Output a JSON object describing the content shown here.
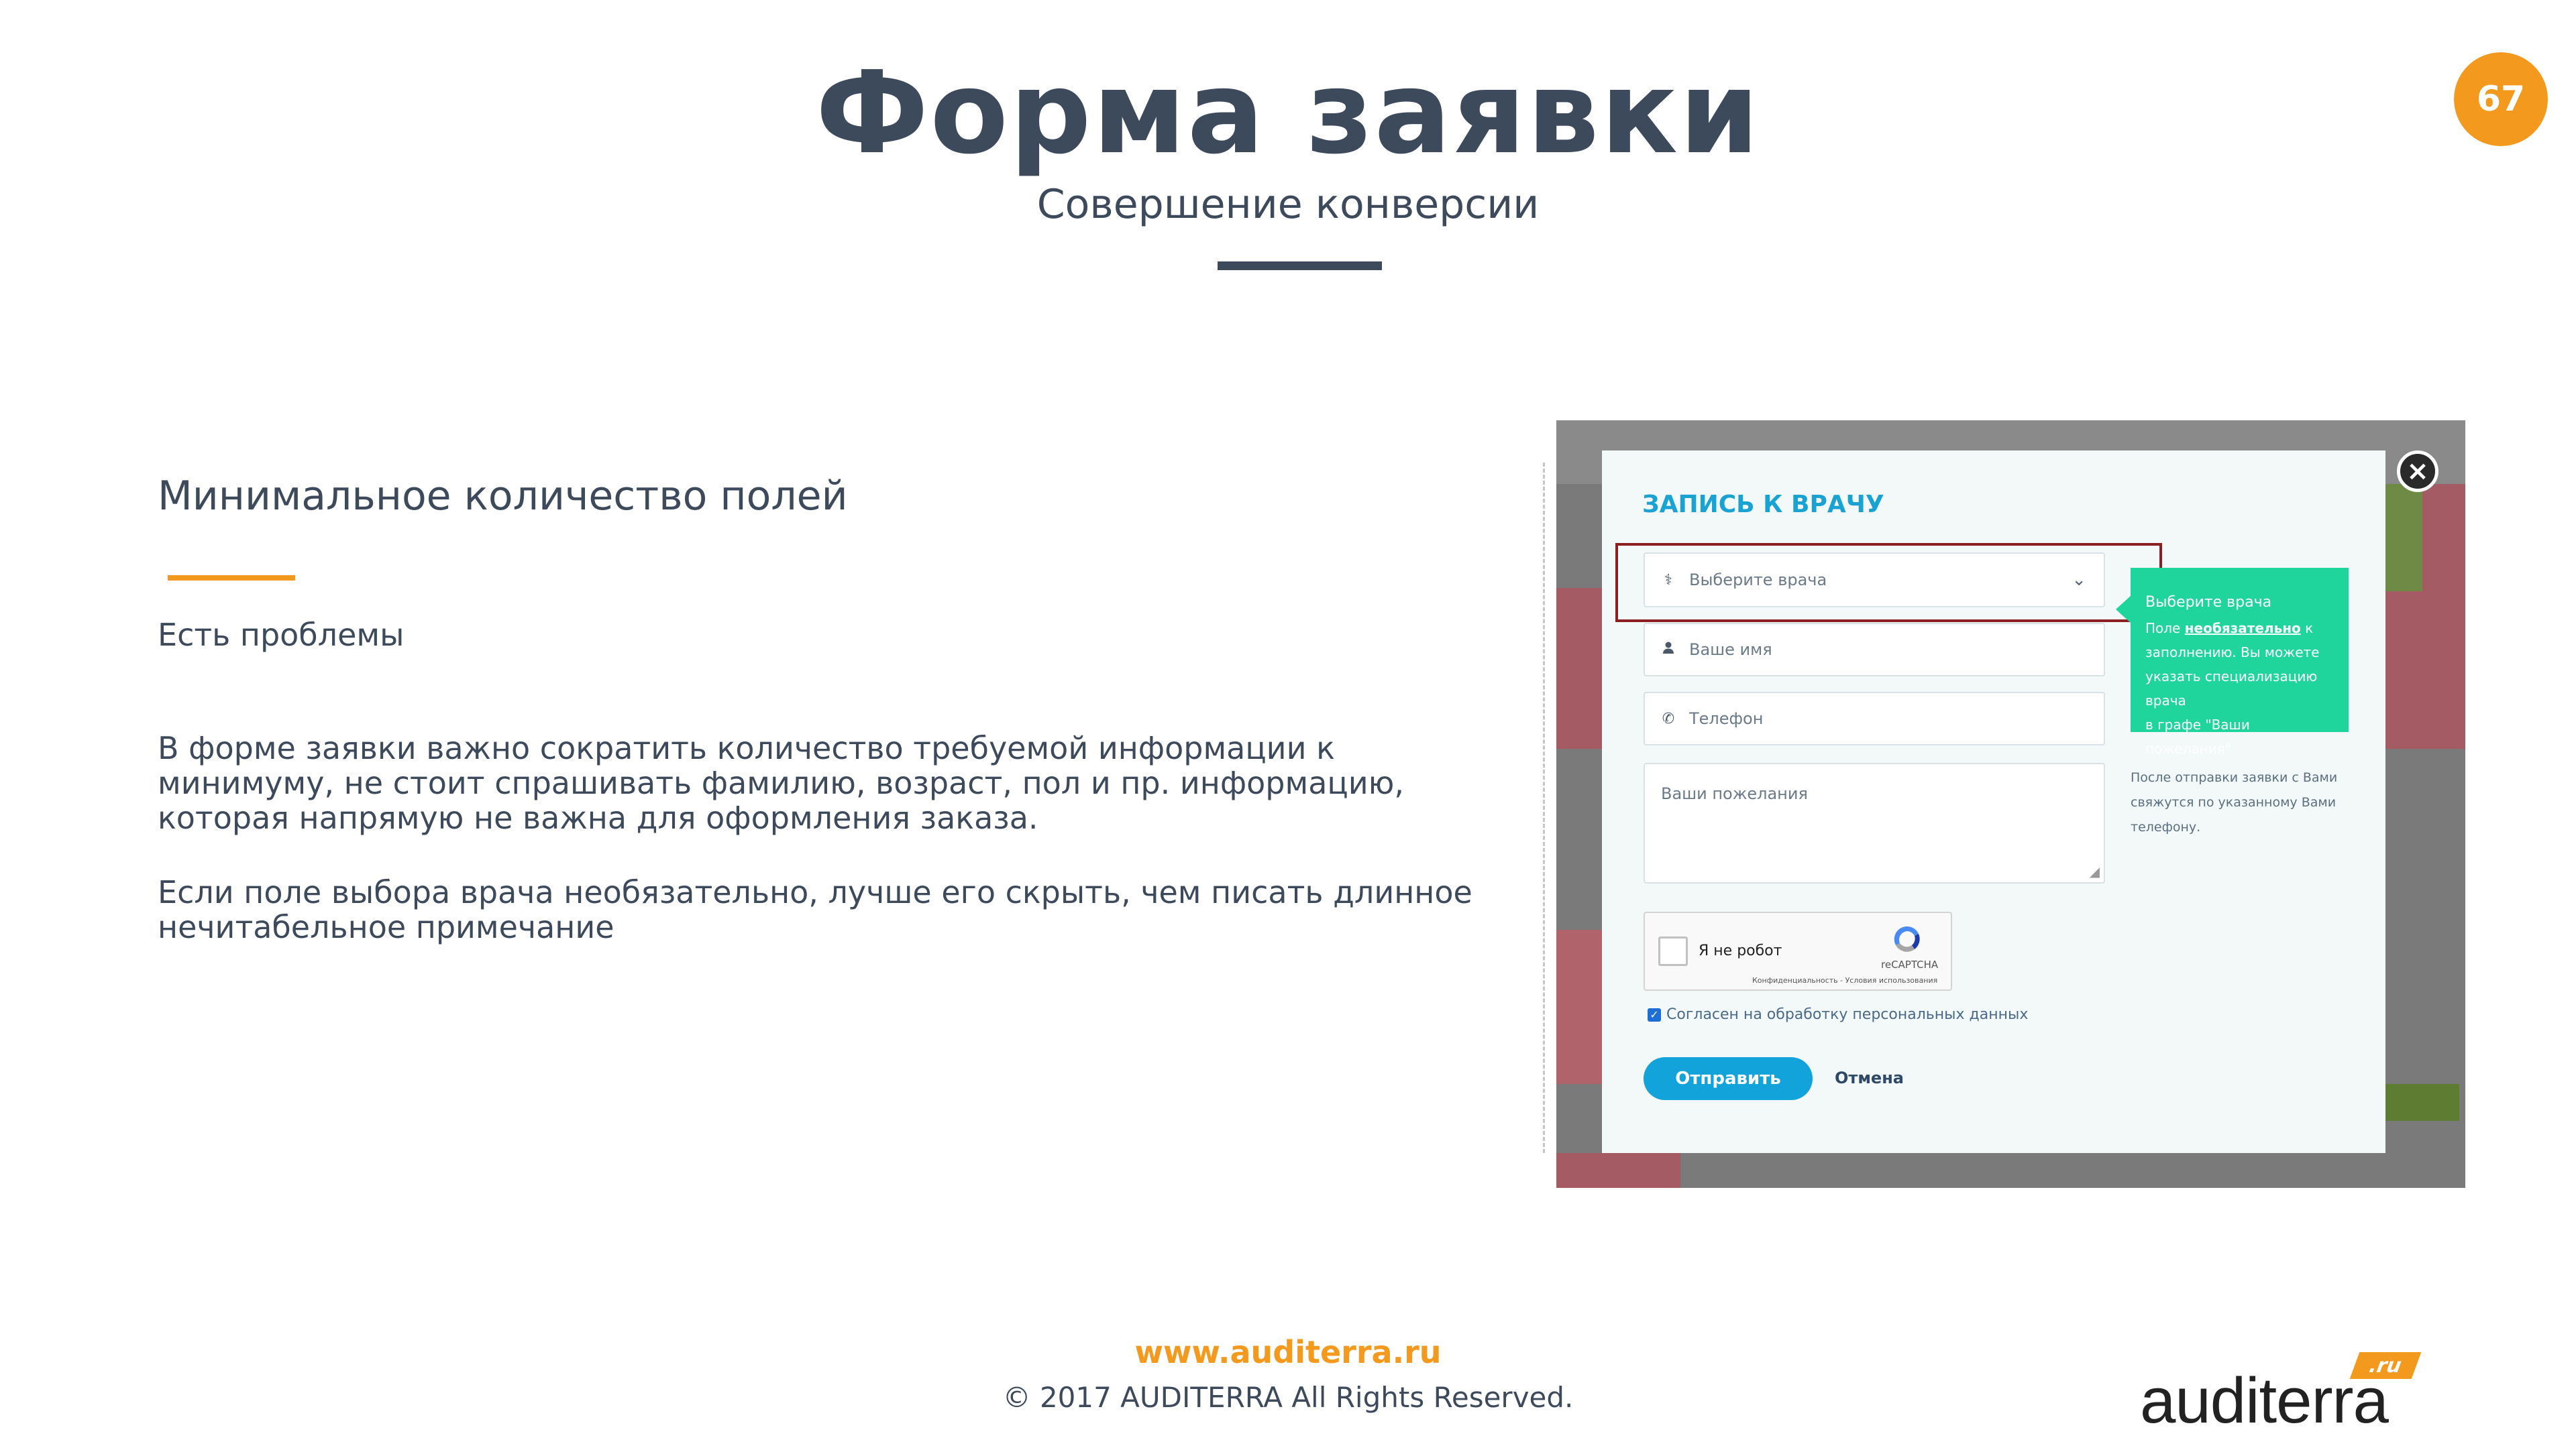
{
  "header": {
    "title": "Форма заявки",
    "subtitle": "Совершение конверсии",
    "page_number": "67"
  },
  "content": {
    "heading": "Минимальное количество полей",
    "problems_label": "Есть проблемы",
    "paragraph_1": "В форме заявки важно сократить количество требуемой информации к минимуму, не стоит спрашивать фамилию, возраст, пол и пр. информацию, которая напрямую не важна для оформления заказа.",
    "paragraph_2": "Если поле выбора врача необязательно, лучше его скрыть, чем писать длинное нечитабельное примечание"
  },
  "form": {
    "title": "ЗАПИСЬ К ВРАЧУ",
    "close_icon": "×",
    "doctor_placeholder": "Выберите врача",
    "name_placeholder": "Ваше имя",
    "phone_placeholder": "Телефон",
    "wishes_placeholder": "Ваши пожелания",
    "tooltip": {
      "title": "Выберите врача",
      "line_1_pre": "Поле ",
      "line_1_strong": "необязательно",
      "line_1_post": " к",
      "line_2": "заполнению. Вы можете",
      "line_3": "указать специализацию врача",
      "line_4": "в графе \"Ваши пожелания\""
    },
    "after_note": "После отправки заявки с Вами свяжутся по указанному Вами телефону.",
    "captcha": {
      "label": "Я не робот",
      "brand": "reCAPTCHA",
      "terms": "Конфиденциальность - Условия использования"
    },
    "consent_label": "Согласен на обработку персональных данных",
    "submit_label": "Отправить",
    "cancel_label": "Отмена"
  },
  "footer": {
    "url": "www.auditerra.ru",
    "copyright": "© 2017 AUDITERRA  All Rights Reserved."
  },
  "brand": {
    "name": "auditerra",
    "tld": ".ru"
  },
  "colors": {
    "accent": "#f39a1e",
    "text": "#3d4a5c",
    "tooltip": "#1fd59c",
    "button": "#12a3da",
    "highlight": "#8b1f22"
  },
  "icons": {
    "doctor": "doctor-icon",
    "user": "user-icon",
    "phone": "phone-icon",
    "chevron": "chevron-down-icon",
    "close": "close-icon"
  }
}
